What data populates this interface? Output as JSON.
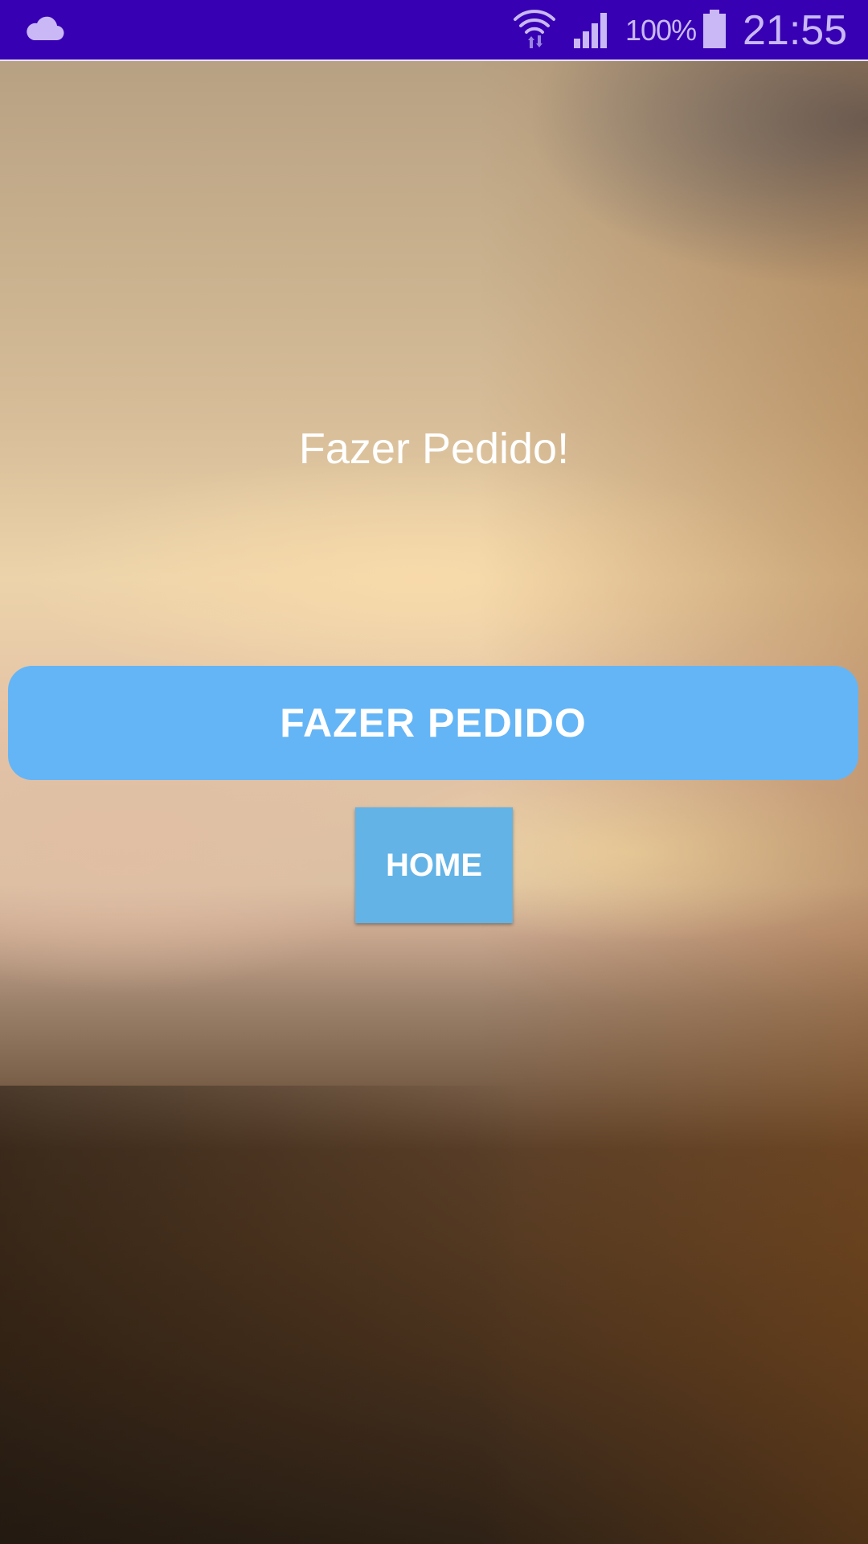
{
  "status_bar": {
    "background": "#3700b3",
    "icon_color": "#c9b8f5",
    "notification_icon": "cloud-icon",
    "wifi_icon": "wifi-icon",
    "signal_icon": "signal-icon",
    "battery_percent": "100%",
    "battery_level": 1.0,
    "battery_icon": "battery-icon",
    "time": "21:55"
  },
  "main": {
    "title": "Fazer Pedido!",
    "primary_button": {
      "label": "FAZER PEDIDO",
      "color": "#64b5f6"
    },
    "home_button": {
      "label": "HOME",
      "color": "#63b3e6"
    }
  }
}
